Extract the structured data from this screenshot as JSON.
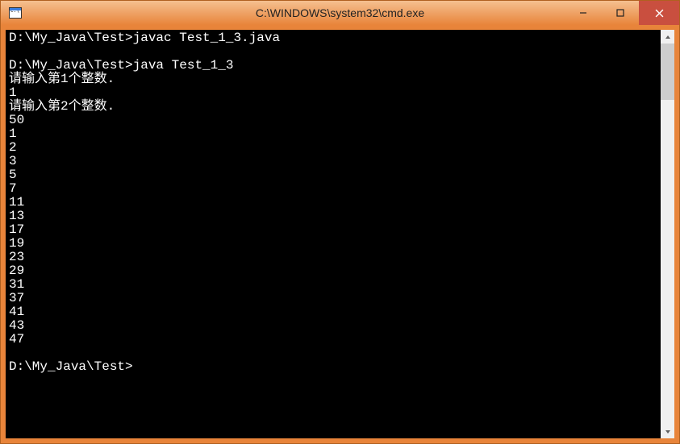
{
  "titlebar": {
    "title": "C:\\WINDOWS\\system32\\cmd.exe"
  },
  "console": {
    "lines": [
      "D:\\My_Java\\Test>javac Test_1_3.java",
      "",
      "D:\\My_Java\\Test>java Test_1_3",
      "请输入第1个整数.",
      "1",
      "请输入第2个整数.",
      "50",
      "1",
      "2",
      "3",
      "5",
      "7",
      "11",
      "13",
      "17",
      "19",
      "23",
      "29",
      "31",
      "37",
      "41",
      "43",
      "47",
      "",
      "D:\\My_Java\\Test>"
    ]
  }
}
